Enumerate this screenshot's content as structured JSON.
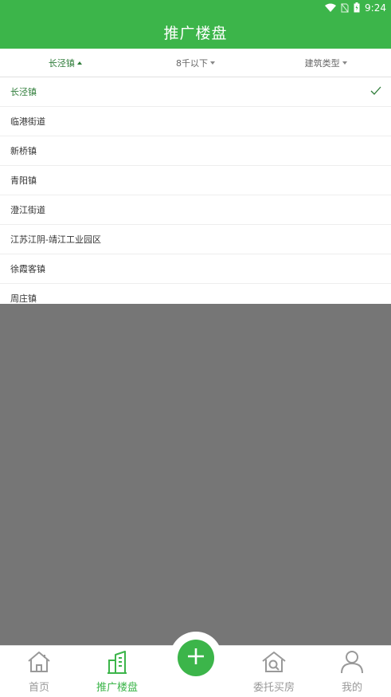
{
  "status_bar": {
    "time": "9:24"
  },
  "header": {
    "title": "推广楼盘"
  },
  "filters": [
    {
      "label": "长泾镇"
    },
    {
      "label": "8千以下"
    },
    {
      "label": "建筑类型"
    }
  ],
  "dropdown": {
    "items": [
      {
        "label": "长泾镇"
      },
      {
        "label": "临港街道"
      },
      {
        "label": "新桥镇"
      },
      {
        "label": "青阳镇"
      },
      {
        "label": "澄江街道"
      },
      {
        "label": "江苏江阴-靖江工业园区"
      },
      {
        "label": "徐霞客镇"
      },
      {
        "label": "周庄镇"
      }
    ]
  },
  "tabs": [
    {
      "label": "首页",
      "icon": "home-icon"
    },
    {
      "label": "推广楼盘",
      "icon": "building-icon"
    },
    {
      "label": "委托买房",
      "icon": "house-search-icon"
    },
    {
      "label": "我的",
      "icon": "person-icon"
    }
  ],
  "fab": {
    "icon": "plus-icon"
  },
  "colors": {
    "brand": "#3cb54a",
    "active_text": "#2f7d3a",
    "overlay": "#767676"
  }
}
